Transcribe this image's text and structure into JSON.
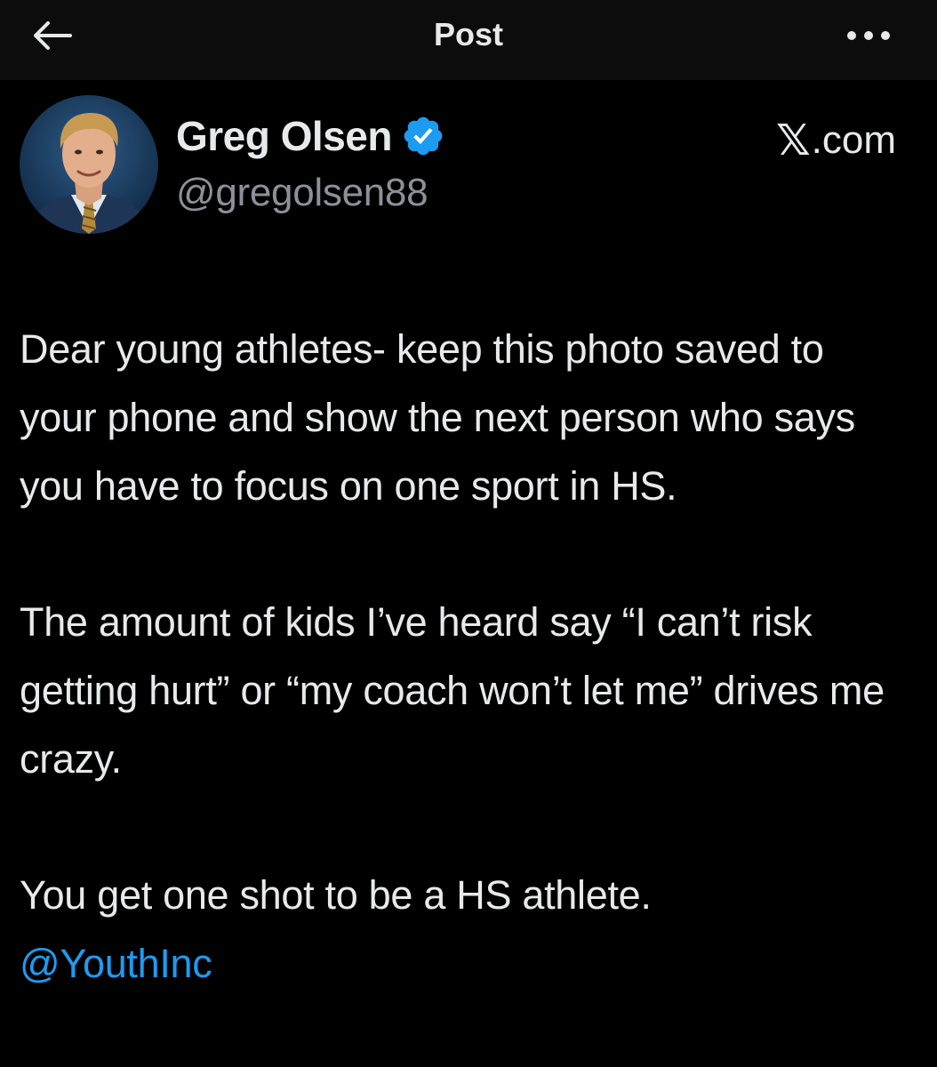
{
  "topbar": {
    "title": "Post",
    "back_icon": "arrow-left-icon",
    "more_icon": "more-horizontal-icon"
  },
  "author": {
    "display_name": "Greg Olsen",
    "handle": "@gregolsen88",
    "verified": true,
    "verified_color": "#1d9bf0"
  },
  "source": {
    "mark": "𝕏",
    "suffix": ".com"
  },
  "post": {
    "paragraph_1": "Dear young athletes- keep this photo saved to your phone and show the next person who says you have to focus on one sport in HS.",
    "paragraph_2": "The amount of kids I’ve heard say “I can’t risk getting hurt” or “my coach won’t let me” drives me crazy.",
    "paragraph_3": "You get one shot to be a HS athlete.",
    "mention": "@YouthInc"
  },
  "colors": {
    "background": "#000000",
    "topbar": "#0c0c0c",
    "text": "#e7e9ea",
    "secondary": "#8b9199",
    "link": "#1d9bf0"
  }
}
